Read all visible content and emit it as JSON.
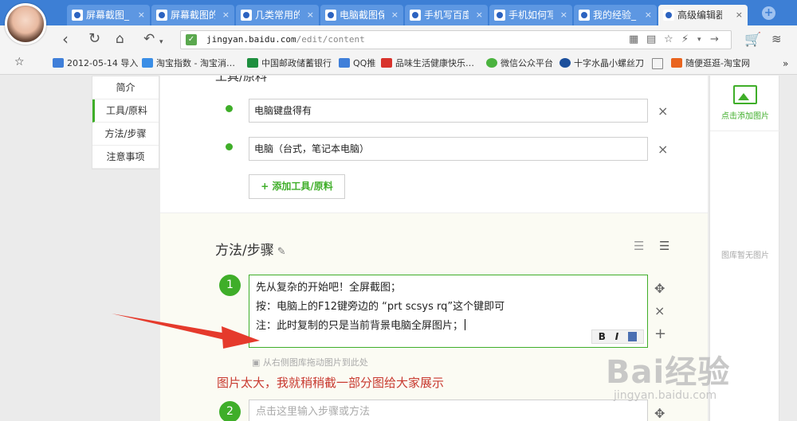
{
  "browser": {
    "tabs": [
      {
        "label": "屏幕截图_",
        "active": false
      },
      {
        "label": "屏幕截图的",
        "active": false
      },
      {
        "label": "几类常用的",
        "active": false
      },
      {
        "label": "电脑截图保",
        "active": false
      },
      {
        "label": "手机写百度",
        "active": false
      },
      {
        "label": "手机如何写",
        "active": false
      },
      {
        "label": "我的经验_",
        "active": false
      },
      {
        "label": "高级编辑器",
        "active": true
      }
    ],
    "new_tab_glyph": "+",
    "close_glyph": "×",
    "url_domain": "jingyan.baidu.com",
    "url_path": "/edit/content",
    "secure_icon": "check-shield-icon"
  },
  "bookmarks": [
    {
      "label": "2012-05-14 导入",
      "icon": "folder-icon",
      "color": "#3f7fd9"
    },
    {
      "label": "淘宝指数 - 淘宝消…",
      "icon": "taobao-icon",
      "color": "#3a8ee6"
    },
    {
      "label": "中国邮政储蓄银行",
      "icon": "bank-icon",
      "color": "#1e8f3f"
    },
    {
      "label": "QQ推",
      "icon": "folder-icon",
      "color": "#3f7fd9"
    },
    {
      "label": "品味生活健康快乐…",
      "icon": "weibo-icon",
      "color": "#d8322b"
    },
    {
      "label": "微信公众平台",
      "icon": "wechat-icon",
      "color": "#4bb33f"
    },
    {
      "label": "十字水晶小螺丝刀",
      "icon": "jd-icon",
      "color": "#1b4f9c"
    },
    {
      "label": "随便逛逛-淘宝网",
      "icon": "tmall-icon",
      "color": "#e9641e"
    }
  ],
  "leftnav": {
    "items": [
      "简介",
      "工具/原料",
      "方法/步骤",
      "注意事项"
    ],
    "active_index": 1
  },
  "tools": {
    "header_partial": "工具/原料",
    "items": [
      "电脑键盘得有",
      "电脑（台式，笔记本电脑）"
    ],
    "add_button": "+ 添加工具/原料"
  },
  "steps": {
    "title": "方法/步骤",
    "step1": {
      "number": "1",
      "lines": [
        "先从复杂的开始吧！全屏截图；",
        "按：电脑上的F12键旁边的 “prt scsys rq”这个键即可",
        "注：此时复制的只是当前背景电脑全屏图片；"
      ]
    },
    "editor_tools": {
      "bold": "B",
      "italic": "I"
    },
    "drop_hint": "从右侧图库拖动图片到此处",
    "annotation": "图片太大，我就稍稍截一部分图给大家展示",
    "step2": {
      "number": "2",
      "placeholder": "点击这里输入步骤或方法"
    }
  },
  "right_panel": {
    "add_image": "点击添加图片",
    "empty": "图库暂无图片"
  },
  "watermark": {
    "brand": "Bai经验",
    "url": "jingyan.baidu.com"
  },
  "colors": {
    "accent_green": "#3fae29",
    "tab_blue": "#3d7fd5",
    "annotation_red": "#c8392f",
    "arrow_red": "#e53a2c"
  }
}
